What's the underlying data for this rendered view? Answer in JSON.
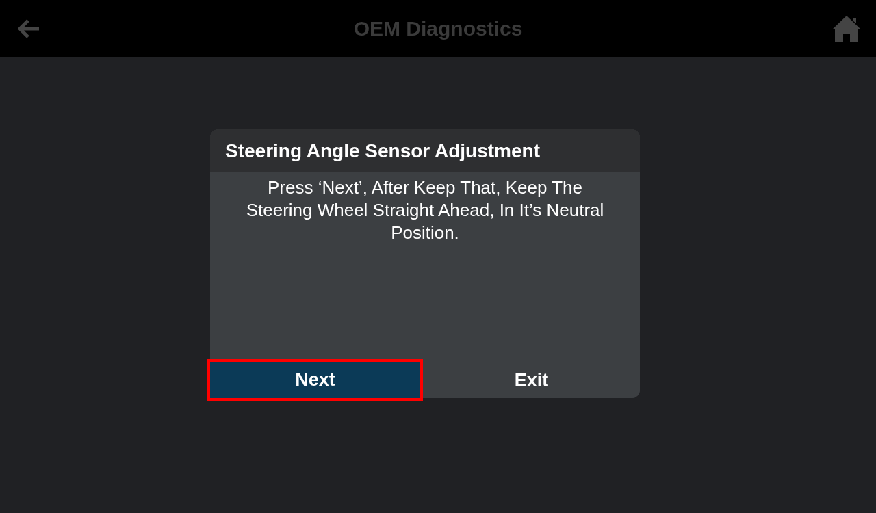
{
  "top_bar": {
    "title": "OEM Diagnostics"
  },
  "dialog": {
    "title": "Steering Angle Sensor Adjustment",
    "message": "Press ‘Next’, After Keep That, Keep The Steering Wheel Straight Ahead, In It’s Neutral Position.",
    "buttons": [
      {
        "label": "Next",
        "selected": true,
        "highlighted": true
      },
      {
        "label": "Exit",
        "selected": false,
        "highlighted": false
      }
    ]
  }
}
